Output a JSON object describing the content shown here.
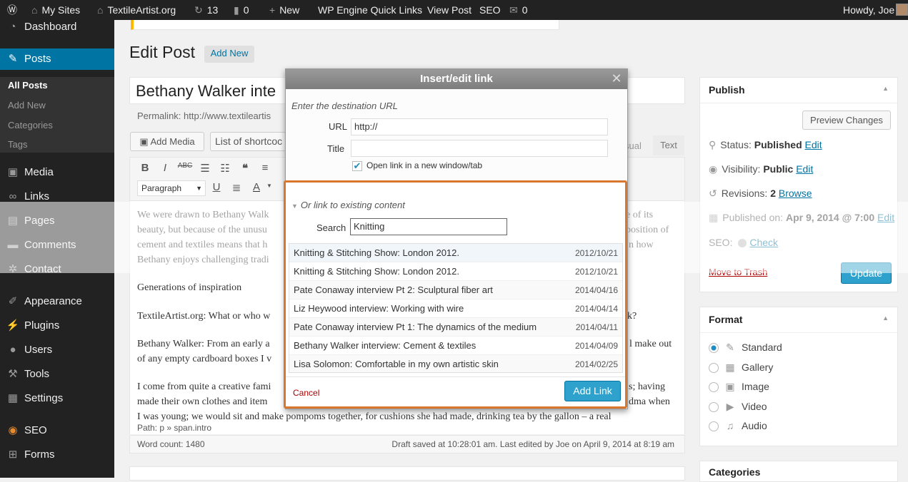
{
  "adminbar": {
    "my_sites": "My Sites",
    "site": "TextileArtist.org",
    "updates": "13",
    "comments": "0",
    "new": "New",
    "wpengine": "WP Engine Quick Links",
    "view_post": "View Post",
    "seo": "SEO",
    "messages": "0",
    "howdy": "Howdy, Joe"
  },
  "sidebar": {
    "dashboard": "Dashboard",
    "posts": "Posts",
    "all_posts": "All Posts",
    "add_new": "Add New",
    "categories": "Categories",
    "tags": "Tags",
    "media": "Media",
    "links": "Links",
    "pages": "Pages",
    "comments": "Comments",
    "contact": "Contact",
    "appearance": "Appearance",
    "plugins": "Plugins",
    "users": "Users",
    "tools": "Tools",
    "settings": "Settings",
    "seo": "SEO",
    "forms": "Forms"
  },
  "editor": {
    "heading": "Edit Post",
    "add_new": "Add New",
    "post_title": "Bethany Walker inte",
    "permalink": "Permalink: http://www.textileartis",
    "add_media": "Add Media",
    "shortcodes": "List of shortcoc",
    "visual_tab": "sual",
    "text_tab": "Text",
    "format_select": "Paragraph",
    "paragraphs": [
      "We were drawn to Bethany Walk",
      "beauty, but because of the unusu",
      "cement and textiles means that h",
      "Bethany enjoys challenging tradi",
      "Generations of inspiration",
      "TextileArtist.org: What or who w",
      "Bethany Walker: From an early a",
      "of any empty cardboard boxes I v",
      "I come from quite a creative fami",
      "made their own clothes and item",
      "I was young; we would sit and make pompoms together, for cushions she had made, drinking tea by the gallon – a real"
    ],
    "right_fragments": [
      "e of its",
      "position of",
      "n how",
      "k?",
      "l make out",
      "s; having",
      "dma when"
    ],
    "path": "Path: p » span.intro",
    "word_count": "Word count: 1480",
    "draft_saved": "Draft saved at 10:28:01 am. Last edited by Joe on April 9, 2014 at 8:19 am"
  },
  "publish": {
    "title": "Publish",
    "preview": "Preview Changes",
    "status_label": "Status: ",
    "status_value": "Published",
    "visibility_label": "Visibility: ",
    "visibility_value": "Public",
    "revisions_label": "Revisions: ",
    "revisions_value": "2",
    "browse": "Browse",
    "published_label": "Published on: ",
    "published_value": "Apr 9, 2014 @ 7:00",
    "edit": "Edit",
    "seo_label": "SEO:",
    "check": "Check",
    "trash": "Move to Trash",
    "update": "Update"
  },
  "format": {
    "title": "Format",
    "options": [
      "Standard",
      "Gallery",
      "Image",
      "Video",
      "Audio"
    ],
    "selected": "Standard"
  },
  "categories_title": "Categories",
  "dialog": {
    "title": "Insert/edit link",
    "enter_url": "Enter the destination URL",
    "url_label": "URL",
    "url_value": "http://",
    "title_label": "Title",
    "title_value": "",
    "new_window": "Open link in a new window/tab",
    "new_window_checked": true,
    "existing_toggle": "Or link to existing content",
    "search_label": "Search",
    "search_value": "Knitting",
    "results": [
      {
        "title": "Knitting & Stitching Show: London 2012.",
        "date": "2012/10/21"
      },
      {
        "title": "Knitting & Stitching Show: London 2012.",
        "date": "2012/10/21"
      },
      {
        "title": "Pate Conaway interview Pt 2: Sculptural fiber art",
        "date": "2014/04/16"
      },
      {
        "title": "Liz Heywood interview: Working with wire",
        "date": "2014/04/14"
      },
      {
        "title": "Pate Conaway interview Pt 1: The dynamics of the medium",
        "date": "2014/04/11"
      },
      {
        "title": "Bethany Walker interview: Cement & textiles",
        "date": "2014/04/09"
      },
      {
        "title": "Lisa Solomon: Comfortable in my own artistic skin",
        "date": "2014/02/25"
      }
    ],
    "cancel": "Cancel",
    "add_link": "Add Link"
  },
  "colors": {
    "accent": "#0074a2",
    "highlight_border": "#d9772e",
    "admin_bar": "#222222"
  }
}
